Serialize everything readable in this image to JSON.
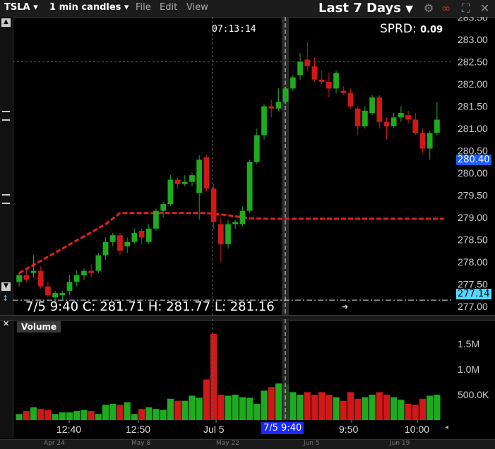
{
  "toolbar": {
    "symbol": "TSLA",
    "candles": "1 min candles",
    "menu_file": "File",
    "menu_edit": "Edit",
    "menu_view": "View",
    "range": "Last 7 Days"
  },
  "crosshair": {
    "time": "07:13:14",
    "x_label": "7/5 9:40"
  },
  "spread": {
    "label": "SPRD:",
    "value": "0.09"
  },
  "info_bar": "7/5 9:40 C: 281.71 H: 281.77 L: 281.16",
  "volume_label": "Volume",
  "price_flags": {
    "current": "280.40",
    "low_line": "277.14"
  },
  "colors": {
    "up": "#1faa1f",
    "down": "#d01818",
    "ma": "#e02020",
    "flag_current": "#1a5cff",
    "flag_low": "#55d8ff"
  },
  "chart_data": {
    "type": "candlestick",
    "ylim": [
      277.0,
      283.7
    ],
    "yticks": [
      "283.50",
      "283.00",
      "282.50",
      "282.00",
      "281.50",
      "281.00",
      "280.50",
      "280.00",
      "279.50",
      "279.00",
      "278.50",
      "278.00",
      "277.50",
      "277.00"
    ],
    "volume_ticks": [
      "1.5M",
      "1.0M",
      "500.0K"
    ],
    "x_ticks": [
      "12:40",
      "12:50",
      "Jul 5",
      "9:50",
      "10:00"
    ],
    "bottom_ticks": [
      "Apr 24",
      "May 8",
      "May 22",
      "Jun 5",
      "Jun 19"
    ],
    "candles": [
      [
        277.55,
        277.75,
        277.45,
        277.7
      ],
      [
        277.7,
        277.85,
        277.55,
        277.6
      ],
      [
        277.75,
        278.15,
        277.65,
        277.8
      ],
      [
        277.8,
        277.9,
        277.4,
        277.45
      ],
      [
        277.45,
        277.55,
        277.2,
        277.25
      ],
      [
        277.2,
        277.35,
        277.1,
        277.3
      ],
      [
        277.25,
        277.35,
        277.15,
        277.3
      ],
      [
        277.35,
        277.7,
        277.25,
        277.55
      ],
      [
        277.55,
        277.8,
        277.45,
        277.7
      ],
      [
        277.7,
        277.85,
        277.6,
        277.8
      ],
      [
        277.8,
        277.95,
        277.65,
        277.75
      ],
      [
        277.8,
        278.2,
        277.75,
        278.15
      ],
      [
        278.15,
        278.55,
        278.05,
        278.45
      ],
      [
        278.45,
        278.65,
        278.35,
        278.6
      ],
      [
        278.6,
        278.65,
        278.15,
        278.25
      ],
      [
        278.35,
        278.55,
        278.2,
        278.45
      ],
      [
        278.45,
        278.75,
        278.4,
        278.65
      ],
      [
        278.7,
        278.75,
        278.4,
        278.55
      ],
      [
        278.45,
        278.85,
        278.4,
        278.75
      ],
      [
        278.75,
        279.2,
        278.7,
        279.15
      ],
      [
        279.15,
        279.35,
        279.0,
        279.3
      ],
      [
        279.3,
        279.95,
        279.25,
        279.85
      ],
      [
        279.85,
        279.9,
        279.65,
        279.75
      ],
      [
        279.75,
        279.95,
        279.7,
        279.8
      ],
      [
        279.8,
        280.0,
        279.7,
        279.95
      ],
      [
        279.55,
        280.4,
        278.95,
        280.3
      ],
      [
        280.35,
        280.4,
        279.6,
        279.65
      ],
      [
        279.65,
        279.75,
        278.75,
        278.9
      ],
      [
        278.85,
        279.0,
        278.0,
        278.4
      ],
      [
        278.4,
        278.95,
        278.3,
        278.85
      ],
      [
        278.85,
        278.95,
        278.75,
        278.9
      ],
      [
        278.85,
        279.25,
        278.8,
        279.15
      ],
      [
        279.15,
        280.3,
        279.1,
        280.25
      ],
      [
        280.25,
        281.0,
        280.2,
        280.85
      ],
      [
        280.85,
        281.55,
        280.75,
        281.5
      ],
      [
        281.5,
        281.65,
        281.25,
        281.45
      ],
      [
        281.45,
        281.9,
        281.4,
        281.6
      ],
      [
        281.6,
        281.95,
        281.55,
        281.9
      ],
      [
        281.9,
        282.2,
        281.85,
        282.15
      ],
      [
        282.2,
        282.7,
        282.1,
        282.5
      ],
      [
        282.55,
        282.95,
        282.3,
        282.4
      ],
      [
        282.4,
        282.6,
        282.05,
        282.1
      ],
      [
        282.1,
        282.3,
        282.0,
        282.05
      ],
      [
        282.05,
        282.25,
        281.7,
        281.9
      ],
      [
        281.9,
        282.3,
        281.8,
        282.25
      ],
      [
        281.85,
        281.95,
        281.75,
        281.8
      ],
      [
        281.8,
        281.9,
        281.45,
        281.5
      ],
      [
        281.45,
        281.5,
        280.85,
        281.05
      ],
      [
        281.05,
        281.5,
        281.0,
        281.4
      ],
      [
        281.35,
        281.75,
        281.3,
        281.7
      ],
      [
        281.7,
        281.75,
        281.0,
        281.15
      ],
      [
        281.15,
        281.25,
        280.75,
        281.05
      ],
      [
        281.05,
        281.35,
        281.0,
        281.25
      ],
      [
        281.25,
        281.5,
        281.15,
        281.35
      ],
      [
        281.3,
        281.4,
        281.1,
        281.2
      ],
      [
        281.2,
        281.35,
        280.85,
        280.9
      ],
      [
        280.9,
        281.0,
        280.45,
        280.55
      ],
      [
        280.55,
        280.95,
        280.3,
        280.9
      ],
      [
        280.9,
        281.6,
        280.85,
        281.2
      ]
    ],
    "volume": [
      0.12,
      0.18,
      0.25,
      0.22,
      0.2,
      0.12,
      0.15,
      0.15,
      0.18,
      0.2,
      0.18,
      0.12,
      0.3,
      0.32,
      0.3,
      0.35,
      0.12,
      0.22,
      0.25,
      0.22,
      0.2,
      0.42,
      0.38,
      0.38,
      0.48,
      0.44,
      0.8,
      1.7,
      0.5,
      0.48,
      0.5,
      0.45,
      0.44,
      0.32,
      0.58,
      0.65,
      0.72,
      0.7,
      0.55,
      0.5,
      0.55,
      0.5,
      0.55,
      0.5,
      0.45,
      0.38,
      0.55,
      0.42,
      0.45,
      0.5,
      0.55,
      0.5,
      0.45,
      0.4,
      0.32,
      0.3,
      0.42,
      0.48,
      0.5
    ],
    "moving_average": [
      [
        0,
        277.75
      ],
      [
        12,
        278.85
      ],
      [
        14,
        279.1
      ],
      [
        20,
        279.1
      ],
      [
        26,
        279.1
      ],
      [
        29,
        279.05
      ],
      [
        32,
        278.98
      ],
      [
        35,
        278.97
      ],
      [
        59,
        278.97
      ]
    ]
  }
}
